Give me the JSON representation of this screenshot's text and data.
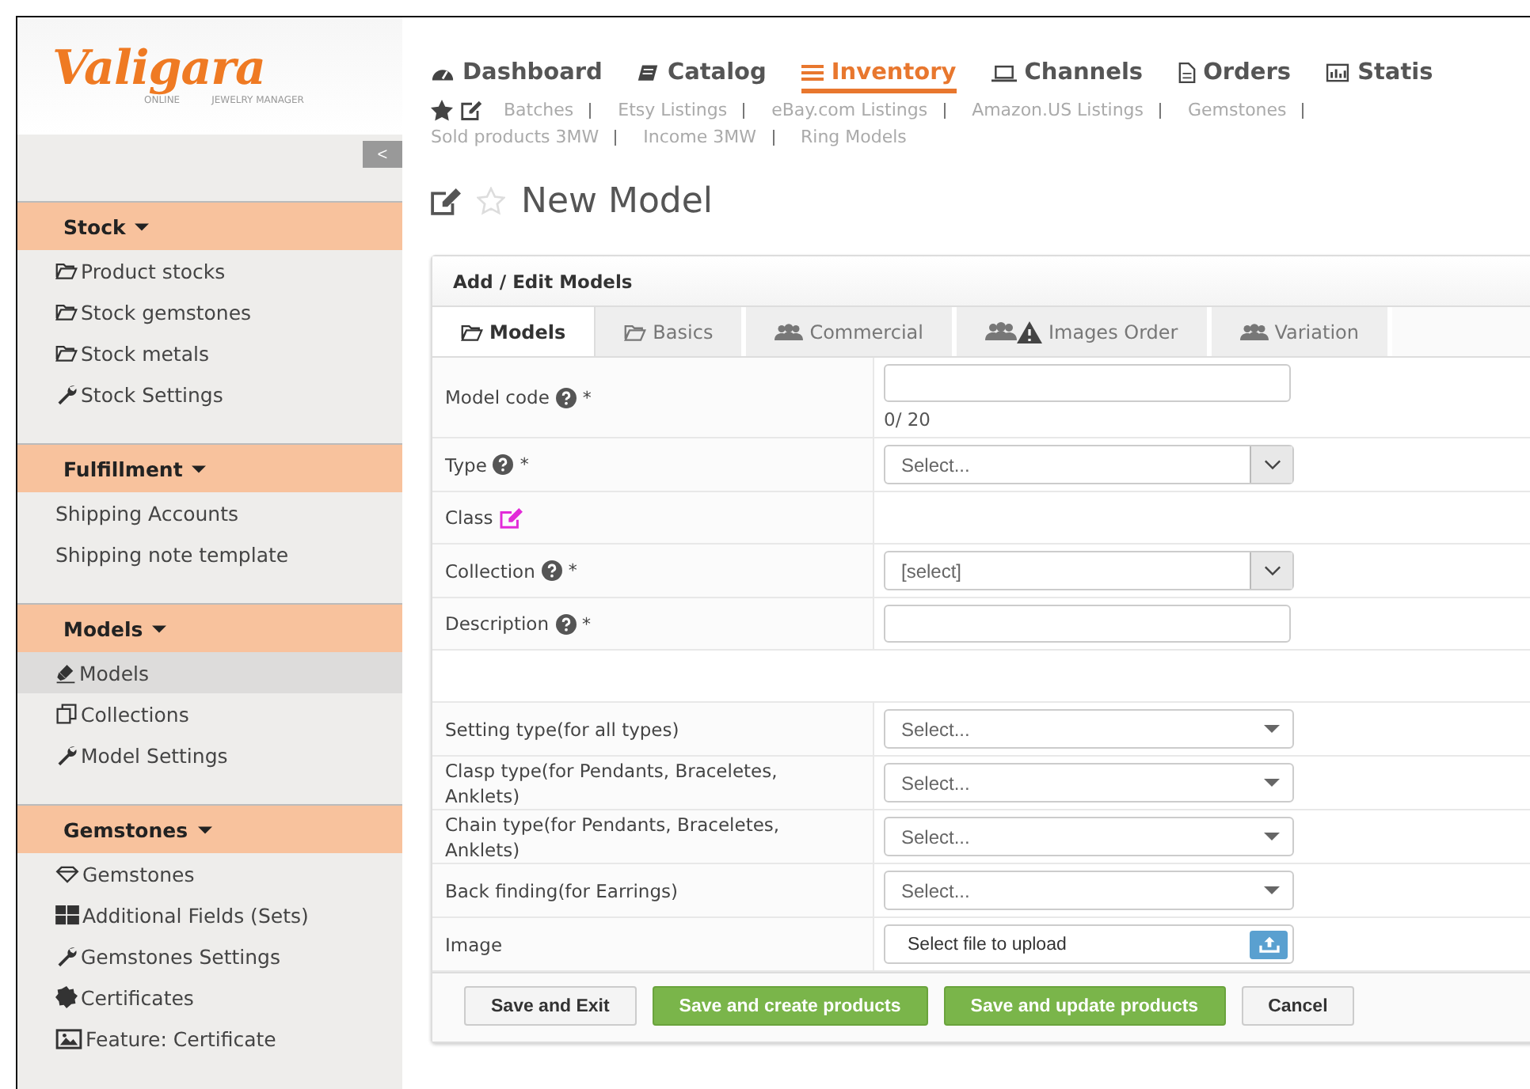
{
  "logo": {
    "name": "Valigara",
    "tagline_left": "ONLINE",
    "tagline_right": "JEWELRY MANAGER"
  },
  "collapse_button": "<",
  "sidebar": [
    {
      "title": "Stock",
      "items": [
        {
          "label": "Product stocks",
          "kind": "folder",
          "selected": false
        },
        {
          "label": "Stock gemstones",
          "kind": "folder",
          "selected": false
        },
        {
          "label": "Stock metals",
          "kind": "folder",
          "selected": false
        },
        {
          "label": "Stock Settings",
          "kind": "wrench",
          "selected": false
        }
      ]
    },
    {
      "title": "Fulfillment",
      "items": [
        {
          "label": "Shipping Accounts",
          "kind": "plain",
          "selected": false
        },
        {
          "label": "Shipping note template",
          "kind": "plain",
          "selected": false
        }
      ]
    },
    {
      "title": "Models",
      "items": [
        {
          "label": "Models",
          "kind": "ring",
          "selected": true
        },
        {
          "label": "Collections",
          "kind": "copy",
          "selected": false
        },
        {
          "label": "Model Settings",
          "kind": "wrench",
          "selected": false
        }
      ]
    },
    {
      "title": "Gemstones",
      "items": [
        {
          "label": "Gemstones",
          "kind": "diamond",
          "selected": false
        },
        {
          "label": "Additional Fields (Sets)",
          "kind": "grid",
          "selected": false
        },
        {
          "label": "Gemstones Settings",
          "kind": "wrench",
          "selected": false
        },
        {
          "label": "Certificates",
          "kind": "badge",
          "selected": false
        },
        {
          "label": "Feature: Certificate",
          "kind": "image",
          "selected": false
        }
      ]
    }
  ],
  "nav": [
    {
      "label": "Dashboard",
      "kind": "gauge",
      "selected": false
    },
    {
      "label": "Catalog",
      "kind": "book",
      "selected": false
    },
    {
      "label": "Inventory",
      "kind": "bars",
      "selected": true
    },
    {
      "label": "Channels",
      "kind": "laptop",
      "selected": false
    },
    {
      "label": "Orders",
      "kind": "file",
      "selected": false
    },
    {
      "label": "Statis",
      "kind": "chart",
      "selected": false
    }
  ],
  "sub_nav": [
    "Batches",
    "Etsy Listings",
    "eBay.com Listings",
    "Amazon.US Listings",
    "Gemstones",
    "Sold products 3MW",
    "Income 3MW",
    "Ring Models"
  ],
  "page_title": "New Model",
  "panel": {
    "title": "Add / Edit Models",
    "tabs": [
      {
        "label": "Models",
        "kind": "folder",
        "selected": true
      },
      {
        "label": "Basics",
        "kind": "folder",
        "selected": false
      },
      {
        "label": "Commercial",
        "kind": "users",
        "selected": false
      },
      {
        "label": "Images Order",
        "kind": "users-warning",
        "selected": false
      },
      {
        "label": "Variation",
        "kind": "users",
        "selected": false
      }
    ],
    "fields": [
      {
        "label": "Model code",
        "kind": "text",
        "help": true,
        "required_mark": "*",
        "counter": "0/ 20"
      },
      {
        "label": "Type",
        "kind": "combo",
        "help": true,
        "required_mark": "*",
        "placeholder": "Select..."
      },
      {
        "label": "Class",
        "kind": "static",
        "help": false
      },
      {
        "label": "Collection",
        "kind": "combo",
        "help": true,
        "required_mark": "*",
        "value": "[select]"
      },
      {
        "label": "Description",
        "kind": "text",
        "help": true,
        "required_mark": "*"
      },
      {
        "kind": "spacer"
      },
      {
        "label": "Setting type(for all types)",
        "kind": "dropdown",
        "help": false,
        "placeholder": "Select..."
      },
      {
        "label": "Clasp type(for Pendants, Braceletes, Anklets)",
        "kind": "dropdown",
        "help": false,
        "placeholder": "Select..."
      },
      {
        "label": "Chain type(for Pendants, Braceletes, Anklets)",
        "kind": "dropdown",
        "help": false,
        "placeholder": "Select..."
      },
      {
        "label": "Back finding(for Earrings)",
        "kind": "dropdown",
        "help": false,
        "placeholder": "Select..."
      },
      {
        "label": "Image",
        "kind": "file",
        "help": false,
        "value": "Select file to upload"
      }
    ],
    "buttons": [
      {
        "label": "Save and Exit",
        "kind": "default"
      },
      {
        "label": "Save and create products",
        "kind": "primary"
      },
      {
        "label": "Save and update products",
        "kind": "primary"
      },
      {
        "label": "Cancel",
        "kind": "default"
      }
    ]
  }
}
